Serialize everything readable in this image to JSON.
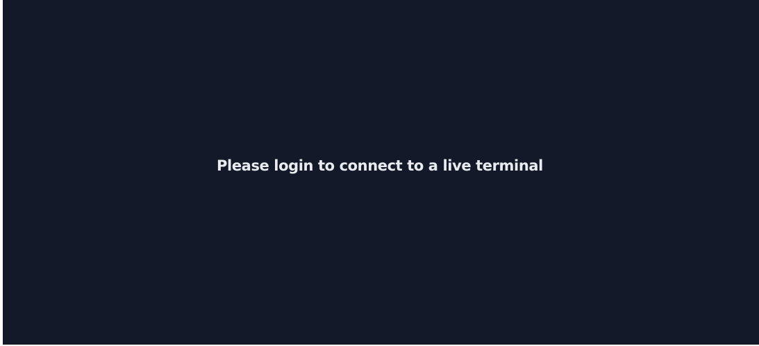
{
  "terminal": {
    "message": "Please login to connect to a live terminal"
  },
  "colors": {
    "background": "#131928",
    "text": "#e8ebf0"
  }
}
